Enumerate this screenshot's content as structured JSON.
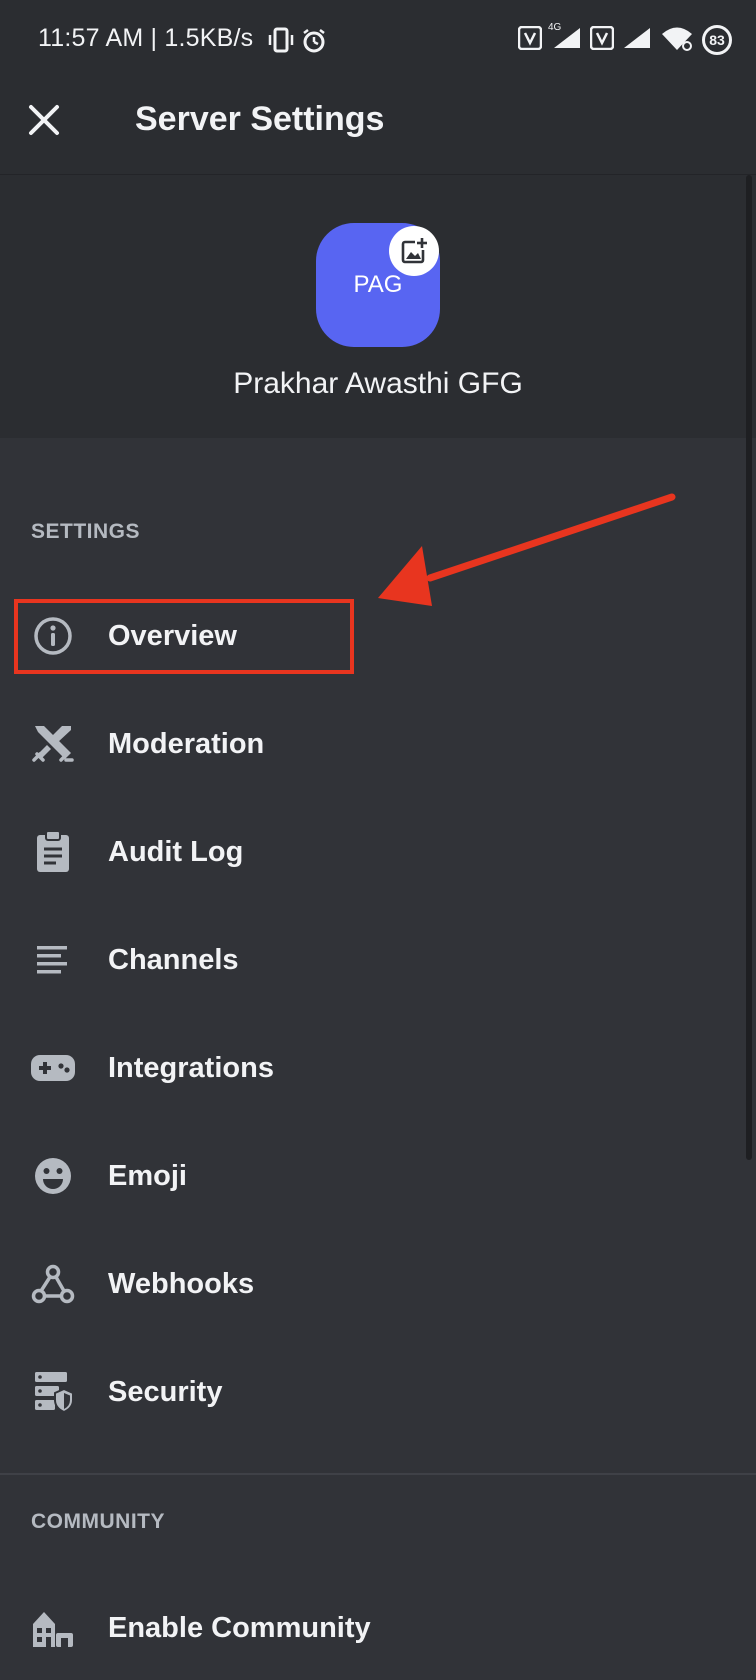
{
  "status_bar": {
    "time": "11:57 AM | 1.5KB/s",
    "battery": "83",
    "network_label": "4G",
    "icons": [
      "vibrate-icon",
      "alarm-icon",
      "volte-icon",
      "signal-icon",
      "wifi-icon",
      "battery-icon"
    ]
  },
  "header": {
    "title": "Server Settings",
    "close_icon": "close-icon"
  },
  "server": {
    "initials": "PAG",
    "name": "Prakhar Awasthi GFG",
    "icon_color": "#5865f2",
    "upload_icon": "image-add-icon"
  },
  "settings_section": {
    "title": "SETTINGS",
    "items": [
      {
        "label": "Overview",
        "icon": "info-icon"
      },
      {
        "label": "Moderation",
        "icon": "swords-icon"
      },
      {
        "label": "Audit Log",
        "icon": "clipboard-icon"
      },
      {
        "label": "Channels",
        "icon": "list-icon"
      },
      {
        "label": "Integrations",
        "icon": "gamepad-icon"
      },
      {
        "label": "Emoji",
        "icon": "smiley-icon"
      },
      {
        "label": "Webhooks",
        "icon": "webhook-icon"
      },
      {
        "label": "Security",
        "icon": "server-shield-icon"
      }
    ]
  },
  "community_section": {
    "title": "COMMUNITY",
    "items": [
      {
        "label": "Enable Community",
        "icon": "community-icon"
      }
    ]
  },
  "colors": {
    "background": "#313338",
    "header_background": "#2b2d31",
    "text": "#f2f3f5",
    "muted_text": "#b5bac1",
    "icon": "#b5bac1",
    "annotation": "#e8351f",
    "brand": "#5865f2"
  }
}
